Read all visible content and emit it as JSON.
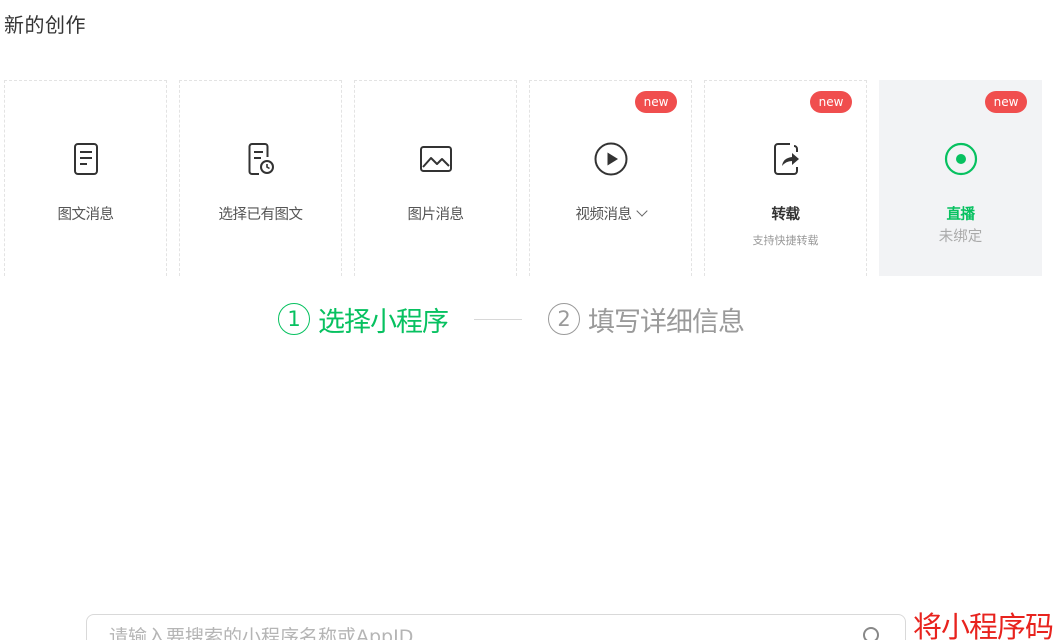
{
  "page_title": "新的创作",
  "cards": [
    {
      "label": "图文消息",
      "icon": "document-icon"
    },
    {
      "label": "选择已有图文",
      "icon": "document-clock-icon"
    },
    {
      "label": "图片消息",
      "icon": "image-icon"
    },
    {
      "label": "视频消息",
      "icon": "play-circle-icon",
      "badge": "new"
    },
    {
      "label": "转载",
      "sub": "支持快捷转载",
      "icon": "repost-icon",
      "badge": "new"
    },
    {
      "label": "直播",
      "sub": "未绑定",
      "icon": "live-icon",
      "badge": "new"
    }
  ],
  "steps": [
    {
      "number": "1",
      "label": "选择小程序",
      "state": "active"
    },
    {
      "number": "2",
      "label": "填写详细信息",
      "state": "idle"
    }
  ],
  "search": {
    "placeholder": "请输入要搜索的小程序名称或AppID",
    "icon": "search-icon"
  },
  "annotation": "将小程序码",
  "colors": {
    "accent": "#07c160",
    "badge": "#f04e4e",
    "annotation": "#e8231e"
  }
}
